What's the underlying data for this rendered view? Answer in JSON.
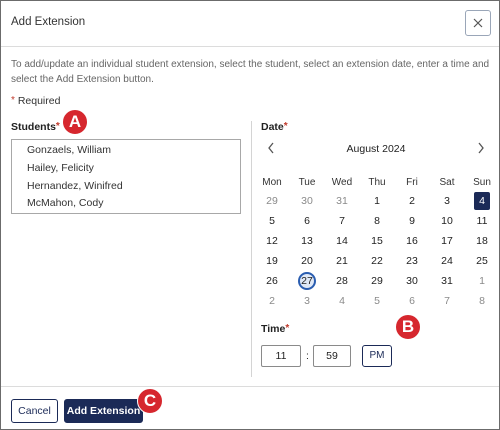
{
  "dialog": {
    "title": "Add Extension",
    "instructions": "To add/update an individual student extension, select the student, select an extension date, enter a time and select the Add Extension button.",
    "required_text": "Required",
    "required_marker": "*"
  },
  "students": {
    "label": "Students",
    "items": [
      "Gonzaels, William",
      "Hailey, Felicity",
      "Hernandez, Winifred",
      "McMahon, Cody"
    ]
  },
  "date": {
    "label": "Date",
    "month_year": "August 2024",
    "prev_icon": "chevron-left-icon",
    "next_icon": "chevron-right-icon",
    "weekdays": [
      "Mon",
      "Tue",
      "Wed",
      "Thu",
      "Fri",
      "Sat",
      "Sun"
    ],
    "weeks": [
      [
        "29",
        "30",
        "31",
        "1",
        "2",
        "3",
        "4"
      ],
      [
        "5",
        "6",
        "7",
        "8",
        "9",
        "10",
        "11"
      ],
      [
        "12",
        "13",
        "14",
        "15",
        "16",
        "17",
        "18"
      ],
      [
        "19",
        "20",
        "21",
        "22",
        "23",
        "24",
        "25"
      ],
      [
        "26",
        "27",
        "28",
        "29",
        "30",
        "31",
        "1"
      ],
      [
        "2",
        "3",
        "4",
        "5",
        "6",
        "7",
        "8"
      ]
    ],
    "selected_day": "4",
    "today_day": "27"
  },
  "time": {
    "label": "Time",
    "hour": "11",
    "separator": ":",
    "minute": "59",
    "ampm": "PM"
  },
  "footer": {
    "cancel_label": "Cancel",
    "add_label": "Add Extension"
  },
  "callouts": {
    "a": "A",
    "b": "B",
    "c": "C"
  },
  "colors": {
    "primary": "#1b2a57",
    "required": "#c0392b",
    "callout": "#d6272e",
    "today_ring": "#2a5db0"
  }
}
